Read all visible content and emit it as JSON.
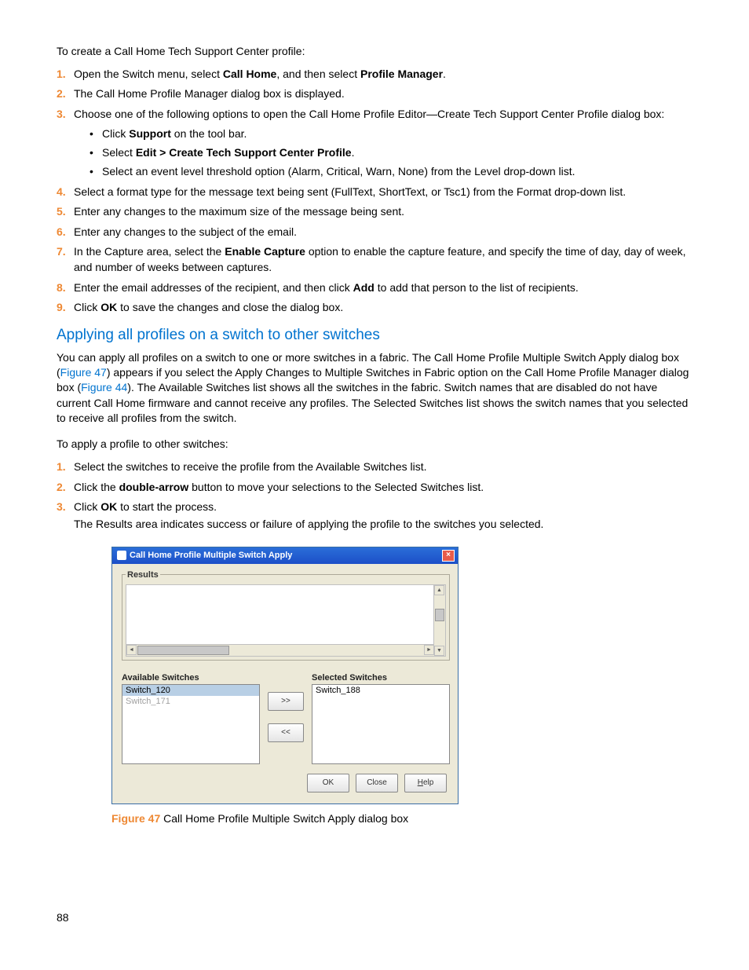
{
  "intro_top": "To create a Call Home Tech Support Center profile:",
  "steps_top": [
    {
      "pre": "Open the Switch menu, select ",
      "b1": "Call Home",
      "mid": ", and then select ",
      "b2": "Profile Manager",
      "post": "."
    },
    {
      "pre": "The Call Home Profile Manager dialog box is displayed.",
      "b1": "",
      "mid": "",
      "b2": "",
      "post": ""
    },
    {
      "pre": "Choose one of the following options to open the Call Home Profile Editor—Create Tech Support Center Profile dialog box:",
      "b1": "",
      "mid": "",
      "b2": "",
      "post": "",
      "bullets": [
        {
          "pre": "Click ",
          "b1": "Support",
          "post": " on the tool bar."
        },
        {
          "pre": "Select ",
          "b1": "Edit > Create Tech Support Center Profile",
          "post": "."
        },
        {
          "pre": "Select an event level threshold option (Alarm, Critical, Warn, None) from the Level drop-down list.",
          "b1": "",
          "post": ""
        }
      ]
    },
    {
      "pre": "Select a format type for the message text being sent (FullText, ShortText, or Tsc1) from the Format drop-down list.",
      "b1": "",
      "mid": "",
      "b2": "",
      "post": ""
    },
    {
      "pre": "Enter any changes to the maximum size of the message being sent.",
      "b1": "",
      "mid": "",
      "b2": "",
      "post": ""
    },
    {
      "pre": "Enter any changes to the subject of the email.",
      "b1": "",
      "mid": "",
      "b2": "",
      "post": ""
    },
    {
      "pre": "In the Capture area, select the ",
      "b1": "Enable Capture",
      "mid": " option to enable the capture feature, and specify the time of day, day of week, and number of weeks between captures.",
      "b2": "",
      "post": ""
    },
    {
      "pre": "Enter the email addresses of the recipient, and then click ",
      "b1": "Add",
      "mid": " to add that person to the list of recipients.",
      "b2": "",
      "post": ""
    },
    {
      "pre": "Click ",
      "b1": "OK",
      "mid": " to save the changes and close the dialog box.",
      "b2": "",
      "post": ""
    }
  ],
  "heading": "Applying all profiles on a switch to other switches",
  "body_para_parts": {
    "p1": "You can apply all profiles on a switch to one or more switches in a fabric. The Call Home Profile Multiple Switch Apply dialog box (",
    "x1": "Figure 47",
    "p2": ") appears if you select the Apply Changes to Multiple Switches in Fabric option on the Call Home Profile Manager dialog box (",
    "x2": "Figure 44",
    "p3": "). The Available Switches list shows all the switches in the fabric. Switch names that are disabled do not have current Call Home firmware and cannot receive any profiles. The Selected Switches list shows the switch names that you selected to receive all profiles from the switch."
  },
  "intro_apply": "To apply a profile to other switches:",
  "steps_apply": [
    {
      "pre": "Select the switches to receive the profile from the Available Switches list.",
      "b1": "",
      "mid": "",
      "b2": "",
      "post": ""
    },
    {
      "pre": "Click the ",
      "b1": "double-arrow",
      "mid": " button to move your selections to the Selected Switches list.",
      "b2": "",
      "post": ""
    },
    {
      "pre": "Click ",
      "b1": "OK",
      "mid": " to start the process.",
      "b2": "",
      "post": "",
      "extra": "The Results area indicates success or failure of applying the profile to the switches you selected."
    }
  ],
  "dialog": {
    "title": "Call Home Profile Multiple Switch Apply",
    "results_legend": "Results",
    "avail_label": "Available Switches",
    "sel_label": "Selected Switches",
    "avail_items": [
      {
        "text": "Switch_120",
        "sel": true,
        "dis": false
      },
      {
        "text": "Switch_171",
        "sel": false,
        "dis": true
      }
    ],
    "sel_items": [
      {
        "text": "Switch_188",
        "sel": false,
        "dis": false
      }
    ],
    "btn_add": ">>",
    "btn_remove": "<<",
    "btn_ok": "OK",
    "btn_close": "Close",
    "btn_help": "Help"
  },
  "caption_num": "Figure 47",
  "caption_text": " Call Home Profile Multiple Switch Apply dialog box",
  "page_number": "88"
}
